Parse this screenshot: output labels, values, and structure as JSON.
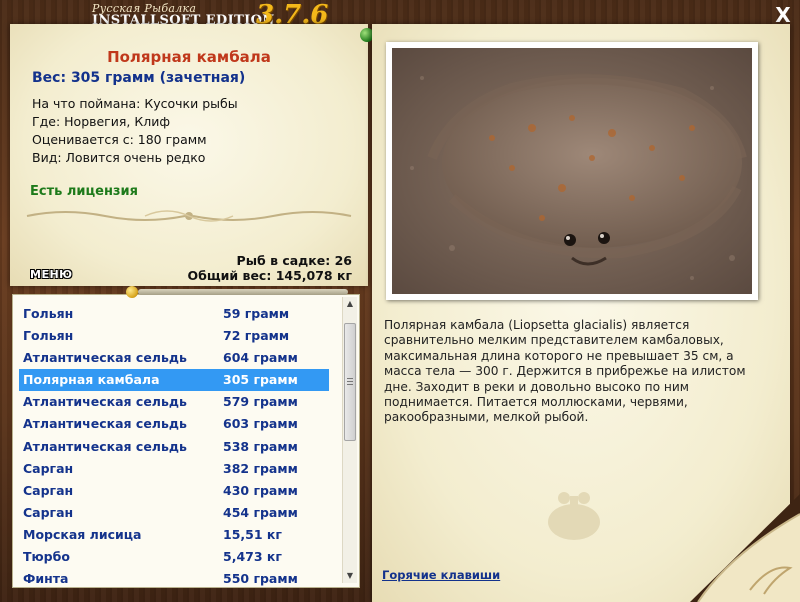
{
  "window": {
    "title_top": "Русская Рыбалка",
    "title_bottom": "INSTALLSOFT EDITION",
    "version": "3.7.6",
    "close_glyph": "X"
  },
  "fish": {
    "name": "Полярная камбала",
    "weight": "Вес: 305 грамм (зачетная)",
    "bait": "На что поймана: Кусочки рыбы",
    "place": "Где: Норвегия, Клиф",
    "valued_from": "Оценивается с: 180 грамм",
    "frequency": "Вид: Ловится очень редко",
    "license": "Есть лицензия"
  },
  "stats": {
    "keep_net": "Рыб в садке: 26",
    "total_weight": "Общий вес: 145,078 кг"
  },
  "menu": {
    "label": "МЕНЮ"
  },
  "catch_list": {
    "selected_index": 3,
    "items": [
      {
        "name": "Гольян",
        "weight": "59 грамм"
      },
      {
        "name": "Гольян",
        "weight": "72 грамм"
      },
      {
        "name": "Атлантическая сельдь",
        "weight": "604 грамм"
      },
      {
        "name": "Полярная камбала",
        "weight": "305 грамм"
      },
      {
        "name": "Атлантическая сельдь",
        "weight": "579 грамм"
      },
      {
        "name": "Атлантическая сельдь",
        "weight": "603 грамм"
      },
      {
        "name": "Атлантическая сельдь",
        "weight": "538 грамм"
      },
      {
        "name": "Сарган",
        "weight": "382 грамм"
      },
      {
        "name": "Сарган",
        "weight": "430 грамм"
      },
      {
        "name": "Сарган",
        "weight": "454 грамм"
      },
      {
        "name": "Морская лисица",
        "weight": "15,51 кг"
      },
      {
        "name": "Тюрбо",
        "weight": "5,473 кг"
      },
      {
        "name": "Финта",
        "weight": "550 грамм"
      }
    ]
  },
  "description": "Полярная камбала (Liopsetta glacialis) является сравнительно мелким представителем камбаловых, максимальная длина которого не превышает 35 см, а масса тела — 300 г. Держится в прибрежье на илистом дне. Заходит в реки и довольно высоко по ним поднимается. Питается моллюсками, червями, ракообразными, мелкой рыбой.",
  "hotkeys": {
    "label": "Горячие клавиши"
  },
  "icons": {
    "close": "close-icon",
    "pin_green": "pin-icon",
    "pin_yellow": "pin-icon",
    "scroll_up": "chevron-up-icon",
    "scroll_down": "chevron-down-icon"
  },
  "colors": {
    "fish_name": "#c0381b",
    "weight": "#13328c",
    "license": "#1d7a1a",
    "list_text": "#14338c",
    "selection": "#3399f3",
    "version": "#f4b81a"
  }
}
